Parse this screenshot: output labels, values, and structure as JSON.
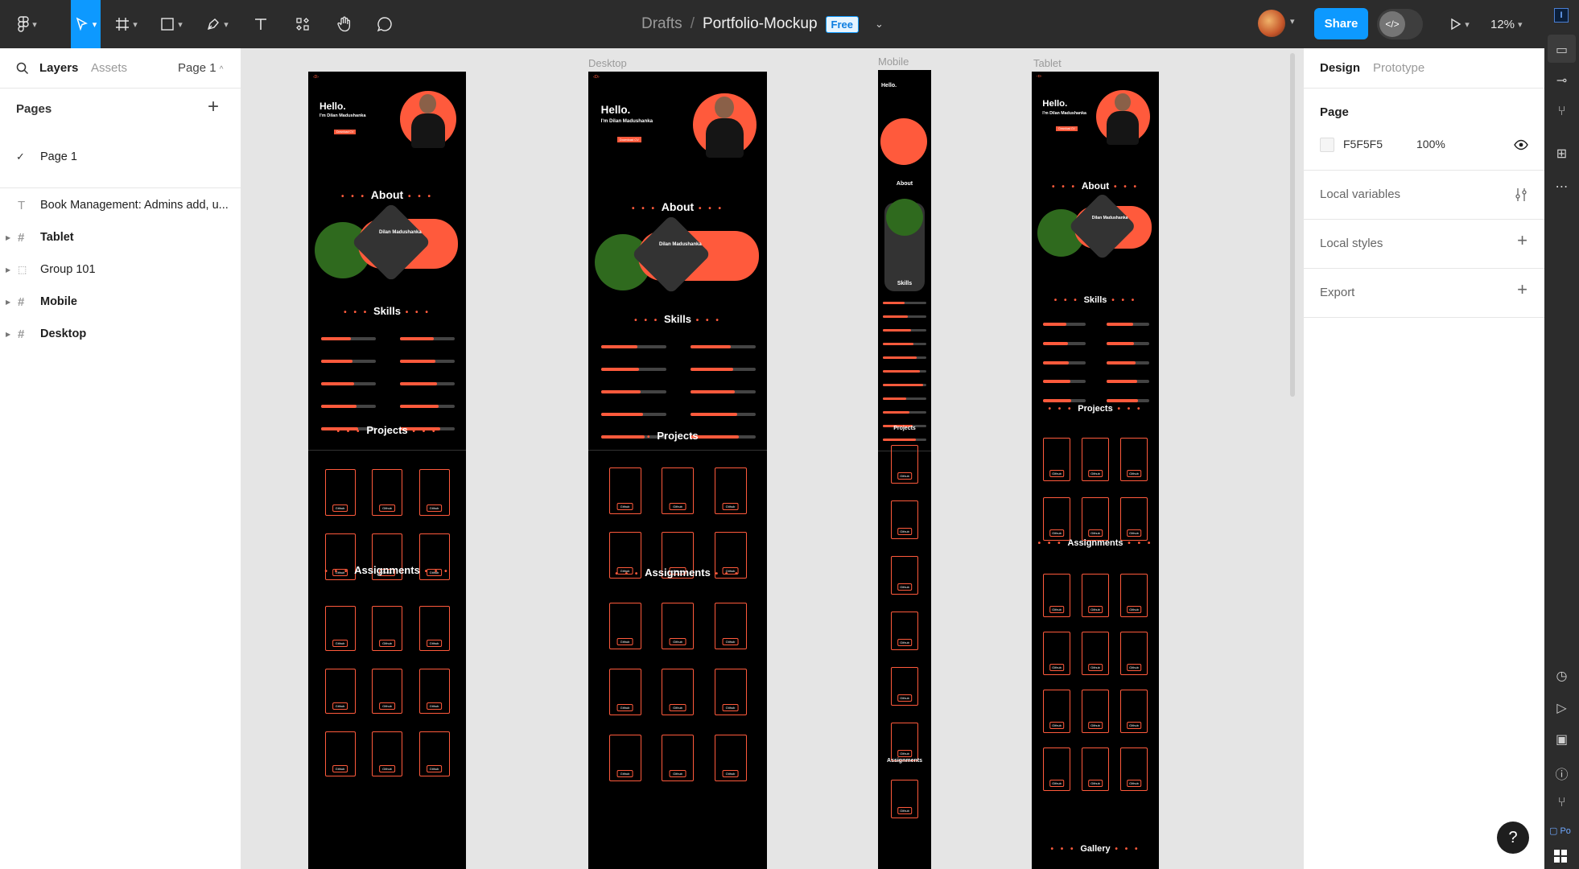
{
  "toolbar": {
    "file_project": "Drafts",
    "file_separator": "/",
    "file_name": "Portfolio-Mockup",
    "plan_badge": "Free",
    "share_label": "Share",
    "zoom_label": "12%"
  },
  "left_panel": {
    "tab_layers": "Layers",
    "tab_assets": "Assets",
    "page_selector": "Page 1",
    "pages_header": "Pages",
    "pages": [
      {
        "label": "Page 1",
        "selected": true
      }
    ],
    "layers": [
      {
        "label": "Book Management: Admins add, u...",
        "icon": "text-icon",
        "bold": false
      },
      {
        "label": "Tablet",
        "icon": "frame-icon",
        "bold": true
      },
      {
        "label": "Group 101",
        "icon": "group-icon",
        "bold": false
      },
      {
        "label": "Mobile",
        "icon": "frame-icon",
        "bold": true
      },
      {
        "label": "Desktop",
        "icon": "frame-icon",
        "bold": true
      }
    ]
  },
  "right_panel": {
    "tab_design": "Design",
    "tab_prototype": "Prototype",
    "page_header": "Page",
    "page_color": "F5F5F5",
    "page_opacity": "100%",
    "local_variables": "Local variables",
    "local_styles": "Local styles",
    "export": "Export"
  },
  "canvas": {
    "frame_labels": {
      "desktop": "Desktop",
      "mobile": "Mobile",
      "tablet": "Tablet"
    },
    "mockup": {
      "hello": "Hello.",
      "name_line": "I'm Dilan Madushanka",
      "download": "Download CV",
      "about": "About",
      "about_name": "Dilan Madushanka",
      "skills": "Skills",
      "projects": "Projects",
      "assignments": "Assignments",
      "gallery": "Gallery",
      "github": "Github"
    }
  },
  "right_rail_icons": [
    "file-icon",
    "component-icon",
    "branch-icon",
    "plugin-icon",
    "more-icon",
    "play-icon",
    "terminal-icon",
    "alert-icon",
    "git-icon"
  ],
  "colors": {
    "accent": "#0d99ff",
    "mockup_accent": "#ff5a3c",
    "toolbar_bg": "#2c2c2c"
  }
}
